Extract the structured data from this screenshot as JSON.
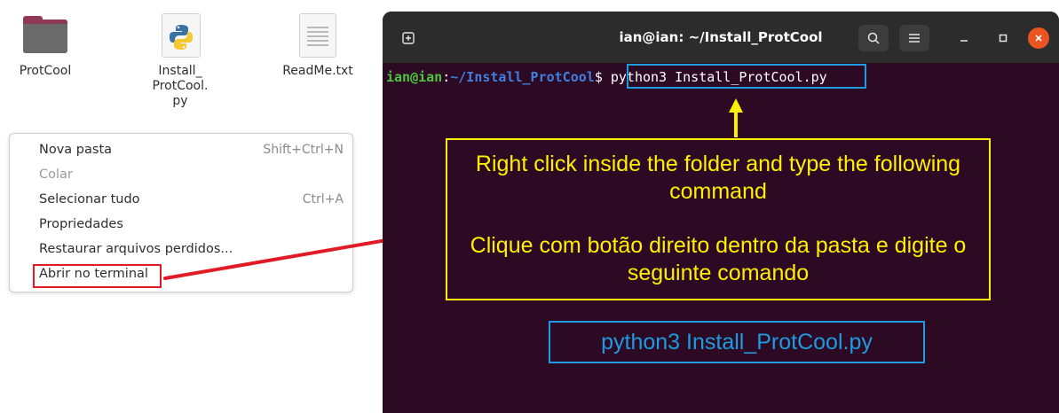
{
  "files": [
    {
      "name": "ProtCool",
      "icon": "folder-icon"
    },
    {
      "name_lines": [
        "Install_",
        "ProtCool.",
        "py"
      ],
      "icon": "python-file-icon"
    },
    {
      "name": "ReadMe.txt",
      "icon": "text-file-icon"
    }
  ],
  "context_menu": {
    "items": [
      {
        "label": "Nova pasta",
        "shortcut": "Shift+Ctrl+N",
        "enabled": true
      },
      {
        "label": "Colar",
        "shortcut": "",
        "enabled": false
      },
      {
        "label": "Selecionar tudo",
        "shortcut": "Ctrl+A",
        "enabled": true
      },
      {
        "label": "Propriedades",
        "shortcut": "",
        "enabled": true
      },
      {
        "label": "Restaurar arquivos perdidos...",
        "shortcut": "",
        "enabled": true
      },
      {
        "label": "Abrir no terminal",
        "shortcut": "",
        "enabled": true,
        "highlighted": true
      }
    ]
  },
  "terminal": {
    "title": "ian@ian: ~/Install_ProtCool",
    "prompt_user": "ian@ian",
    "prompt_sep": ":",
    "prompt_path": "~/Install_ProtCool",
    "prompt_symbol": "$ ",
    "command": "python3 Install_ProtCool.py"
  },
  "annotations": {
    "instruction_en": "Right click inside the folder and type the following command",
    "instruction_pt": "Clique com botão direito dentro da pasta e digite o seguinte comando",
    "command_callout": "python3 Install_ProtCool.py"
  },
  "colors": {
    "terminal_bg": "#2c0a24",
    "titlebar_bg": "#2c2c2c",
    "annotation_yellow": "#ffef00",
    "annotation_blue": "#1e9be0",
    "annotation_red": "#e01b24",
    "prompt_green": "#4ec53d",
    "prompt_blue": "#3f7fe0",
    "close_orange": "#e95420",
    "folder_accent": "#8e3a56"
  }
}
